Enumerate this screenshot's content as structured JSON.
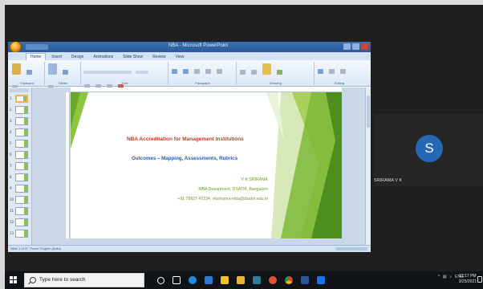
{
  "presentation": {
    "window_title": "NBA - Microsoft PowerPoint",
    "ribbon_tabs": [
      "Home",
      "Insert",
      "Design",
      "Animations",
      "Slide Show",
      "Review",
      "View"
    ],
    "ribbon_groups": [
      "Clipboard",
      "Slides",
      "Font",
      "Paragraph",
      "Drawing",
      "Editing"
    ],
    "status_text": "Slide 1 of 37   \"Facet\"   English (India)",
    "slide": {
      "title": "NBA Accreditation for Management Institutions",
      "subtitle": "Outcomes – Mapping, Assessments, Rubrics",
      "author": "V K SRIRAMA",
      "department": "MBA Department, DSATM, Bangalore",
      "contact": "+91 78927 47234, vksrirama-mba@dsatm.edu.in"
    },
    "thumbnail_numbers": [
      "1",
      "2",
      "3",
      "4",
      "5",
      "6",
      "7",
      "8",
      "9",
      "10",
      "11",
      "12",
      "13"
    ]
  },
  "participant": {
    "initial": "S",
    "name": "SRIRAMA V K",
    "avatar_color": "#2468b6"
  },
  "taskbar": {
    "search_placeholder": "Type here to search",
    "language": "ENG",
    "time": "12:17 PM",
    "date": "3/25/2021",
    "pinned_icons": [
      "task-view-icon",
      "file-explorer-icon",
      "edge-icon",
      "mail-icon",
      "store-icon",
      "word-icon",
      "teams-icon",
      "chrome-icon",
      "photos-icon",
      "outlook-icon"
    ]
  }
}
